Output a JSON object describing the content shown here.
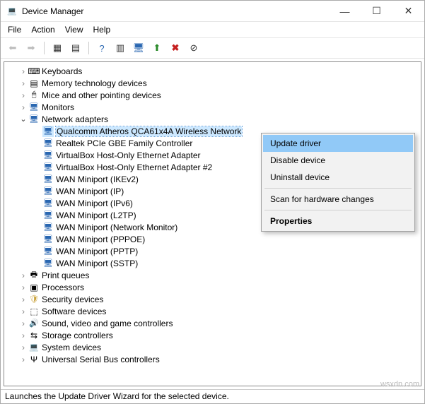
{
  "window": {
    "title": "Device Manager"
  },
  "menu": {
    "file": "File",
    "action": "Action",
    "view": "View",
    "help": "Help"
  },
  "tree": {
    "cat0": "Keyboards",
    "cat1": "Memory technology devices",
    "cat2": "Mice and other pointing devices",
    "cat3": "Monitors",
    "cat4": "Network adapters",
    "na0": "Qualcomm Atheros QCA61x4A Wireless Network",
    "na1": "Realtek PCIe GBE Family Controller",
    "na2": "VirtualBox Host-Only Ethernet Adapter",
    "na3": "VirtualBox Host-Only Ethernet Adapter #2",
    "na4": "WAN Miniport (IKEv2)",
    "na5": "WAN Miniport (IP)",
    "na6": "WAN Miniport (IPv6)",
    "na7": "WAN Miniport (L2TP)",
    "na8": "WAN Miniport (Network Monitor)",
    "na9": "WAN Miniport (PPPOE)",
    "na10": "WAN Miniport (PPTP)",
    "na11": "WAN Miniport (SSTP)",
    "cat5": "Print queues",
    "cat6": "Processors",
    "cat7": "Security devices",
    "cat8": "Software devices",
    "cat9": "Sound, video and game controllers",
    "cat10": "Storage controllers",
    "cat11": "System devices",
    "cat12": "Universal Serial Bus controllers"
  },
  "context_menu": {
    "update": "Update driver",
    "disable": "Disable device",
    "uninstall": "Uninstall device",
    "scan": "Scan for hardware changes",
    "properties": "Properties"
  },
  "status": "Launches the Update Driver Wizard for the selected device.",
  "watermark": "wsxdn.com"
}
